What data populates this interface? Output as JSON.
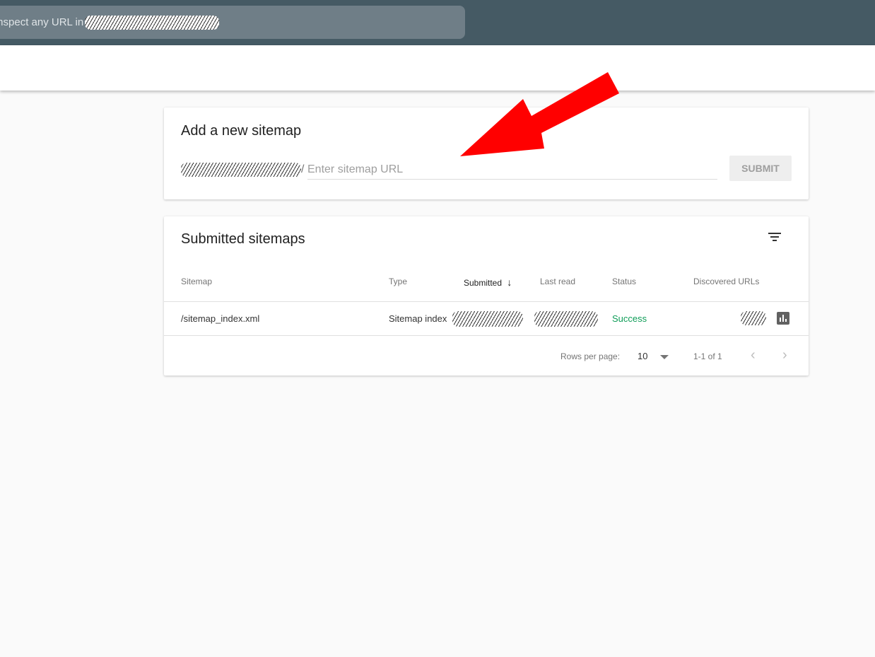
{
  "topbar": {
    "search_placeholder": "Inspect any URL in"
  },
  "add_sitemap": {
    "title": "Add a new sitemap",
    "prefix_separator": "/",
    "placeholder": "Enter sitemap URL",
    "submit_label": "SUBMIT"
  },
  "submitted": {
    "title": "Submitted sitemaps",
    "columns": [
      "Sitemap",
      "Type",
      "Submitted",
      "Last read",
      "Status",
      "Discovered URLs"
    ],
    "sort_indicator": "↓",
    "rows": [
      {
        "sitemap": "/sitemap_index.xml",
        "type": "Sitemap index",
        "status": "Success"
      }
    ],
    "rows_per_page_label": "Rows per page:",
    "rows_per_page": "10",
    "range": "1-1 of 1"
  },
  "colors": {
    "topbar": "#455a64",
    "success": "#0f9d58",
    "arrow": "#ff0000"
  }
}
